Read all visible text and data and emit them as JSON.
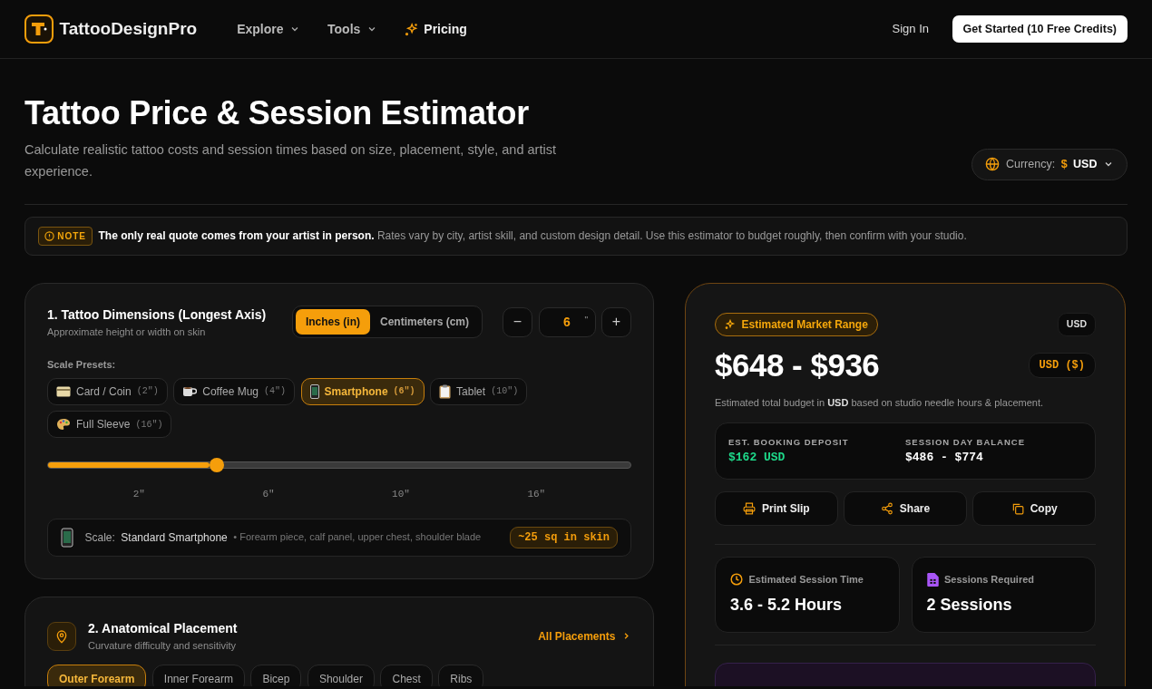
{
  "nav": {
    "brand": "TattooDesignPro",
    "links": [
      {
        "label": "Explore",
        "kind": "dropdown"
      },
      {
        "label": "Tools",
        "kind": "dropdown"
      },
      {
        "label": "Pricing",
        "kind": "featured"
      }
    ],
    "sign_in": "Sign In",
    "cta": "Get Started (10 Free Credits)"
  },
  "header": {
    "title": "Tattoo Price & Session Estimator",
    "subtitle": "Calculate realistic tattoo costs and session times based on size, placement, style, and artist experience.",
    "currency": {
      "label": "Currency:",
      "symbol": "$",
      "value": "USD"
    }
  },
  "note": {
    "badge": "NOTE",
    "text": "**The only real quote comes from your artist in person.** Rates vary by city, artist skill, and custom design detail. Use this estimator to budget roughly, then confirm with your studio."
  },
  "dimensions": {
    "title": "1. Tattoo Dimensions (Longest Axis)",
    "subtitle": "Approximate height or width on skin",
    "units": [
      {
        "label": "Inches (in)",
        "selected": true
      },
      {
        "label": "Centimeters (cm)",
        "selected": false
      }
    ],
    "minus": "−",
    "value": "6",
    "unit_mark": "\"",
    "plus": "+",
    "presets_label": "Scale Presets:",
    "presets": [
      {
        "label": "Card / Coin",
        "size": "(2\")",
        "selected": false
      },
      {
        "label": "Coffee Mug",
        "size": "(4\")",
        "selected": false
      },
      {
        "label": "Smartphone",
        "size": "(6\")",
        "selected": true
      },
      {
        "label": "Tablet",
        "size": "(10\")",
        "selected": false
      },
      {
        "label": "Full Sleeve",
        "size": "(16\")",
        "selected": false
      }
    ],
    "slider": {
      "level": 0.29
    },
    "ticks": [
      "2\"",
      "6\"",
      "10\"",
      "16\""
    ],
    "scale": {
      "label": "Scale:",
      "name": "Standard Smartphone",
      "detail": "• Forearm piece, calf panel, upper chest, shoulder blade",
      "area": "~25 sq in skin"
    }
  },
  "placement": {
    "title": "2. Anatomical Placement",
    "subtitle": "Curvature difficulty and sensitivity",
    "link": "All Placements",
    "options": [
      {
        "label": "Outer Forearm",
        "selected": true
      },
      {
        "label": "Inner Forearm",
        "selected": false
      },
      {
        "label": "Bicep",
        "selected": false
      },
      {
        "label": "Shoulder",
        "selected": false
      },
      {
        "label": "Chest",
        "selected": false
      },
      {
        "label": "Ribs",
        "selected": false
      }
    ]
  },
  "estimate": {
    "badge": "Estimated Market Range",
    "currency_tag": "USD",
    "range": "$648 - $936",
    "currency_pill": "USD ($)",
    "caption": "Estimated total budget in **USD** based on studio needle hours & placement.",
    "deposit": {
      "label": "EST. BOOKING DEPOSIT",
      "value": "$162 USD"
    },
    "balance": {
      "label": "SESSION DAY BALANCE",
      "value": "$486 - $774"
    },
    "actions": [
      "Print Slip",
      "Share",
      "Copy"
    ],
    "stats": [
      {
        "label": "Estimated Session Time",
        "value": "3.6 - 5.2 Hours",
        "color": "#f59e0b"
      },
      {
        "label": "Sessions Required",
        "value": "2 Sessions",
        "color": "#a855f7"
      }
    ]
  }
}
